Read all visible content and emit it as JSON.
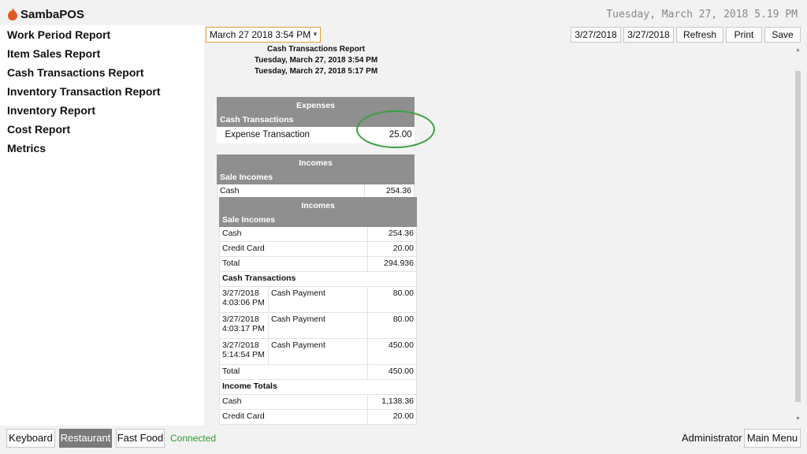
{
  "app": {
    "title": "SambaPOS",
    "clock": "Tuesday, March 27, 2018 5.19 PM",
    "logo_icon": "samba-flame-icon",
    "accent": "#e25822"
  },
  "sidebar": {
    "items": [
      {
        "label": "Work Period Report"
      },
      {
        "label": "Item Sales Report"
      },
      {
        "label": "Cash Transactions Report"
      },
      {
        "label": "Inventory Transaction Report"
      },
      {
        "label": "Inventory Report"
      },
      {
        "label": "Cost Report"
      },
      {
        "label": "Metrics"
      }
    ]
  },
  "toolbar": {
    "date_select_value": "March 27 2018 3:54 PM",
    "start_date": "3/27/2018",
    "end_date": "3/27/2018",
    "refresh_label": "Refresh",
    "print_label": "Print",
    "save_label": "Save"
  },
  "report": {
    "title": "Cash Transactions Report",
    "start": "Tuesday, March 27, 2018 3:54 PM",
    "end": "Tuesday, March 27, 2018 5:17 PM",
    "expenses": {
      "header": "Expenses",
      "section": "Cash Transactions",
      "rows": [
        {
          "label": "Expense Transaction",
          "value": "25.00"
        }
      ]
    },
    "incomes_outer": {
      "header": "Incomes",
      "section": "Sale Incomes",
      "rows": [
        {
          "label": "Cash",
          "value": "254.36"
        }
      ]
    },
    "incomes_inner": {
      "header": "Incomes",
      "section": "Sale Incomes",
      "rows": [
        {
          "label": "Cash",
          "value": "254.36"
        },
        {
          "label": "Credit Card",
          "value": "20.00"
        },
        {
          "label": "Total",
          "value": "294.936"
        }
      ],
      "cash_section": "Cash Transactions",
      "cash_rows": [
        {
          "date": "3/27/2018",
          "time": "4:03:06 PM",
          "desc": "Cash Payment",
          "value": "80.00"
        },
        {
          "date": "3/27/2018",
          "time": "4:03:17 PM",
          "desc": "Cash Payment",
          "value": "80.00"
        },
        {
          "date": "3/27/2018",
          "time": "5:14:54 PM",
          "desc": "Cash Payment",
          "value": "450.00"
        }
      ],
      "cash_total": {
        "label": "Total",
        "value": "450.00"
      },
      "totals_section": "Income Totals",
      "totals_rows": [
        {
          "label": "Cash",
          "value": "1,138.36"
        },
        {
          "label": "Credit Card",
          "value": "20.00"
        }
      ]
    }
  },
  "bottombar": {
    "keyboard_label": "Keyboard",
    "restaurant_label": "Restaurant",
    "fastfood_label": "Fast Food",
    "status_text": "Connected",
    "user_label": "Administrator",
    "main_menu_label": "Main Menu",
    "status_color": "#2f9a2f"
  }
}
